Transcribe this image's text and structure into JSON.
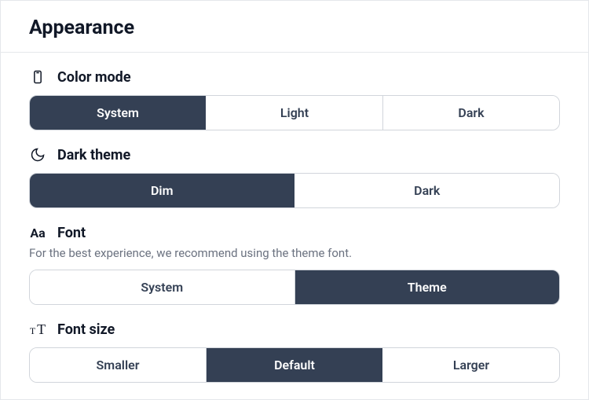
{
  "title": "Appearance",
  "sections": {
    "color_mode": {
      "label": "Color mode",
      "options": [
        "System",
        "Light",
        "Dark"
      ],
      "selected": 0
    },
    "dark_theme": {
      "label": "Dark theme",
      "options": [
        "Dim",
        "Dark"
      ],
      "selected": 0
    },
    "font": {
      "label": "Font",
      "description": "For the best experience, we recommend using the theme font.",
      "options": [
        "System",
        "Theme"
      ],
      "selected": 1
    },
    "font_size": {
      "label": "Font size",
      "options": [
        "Smaller",
        "Default",
        "Larger"
      ],
      "selected": 1
    }
  }
}
